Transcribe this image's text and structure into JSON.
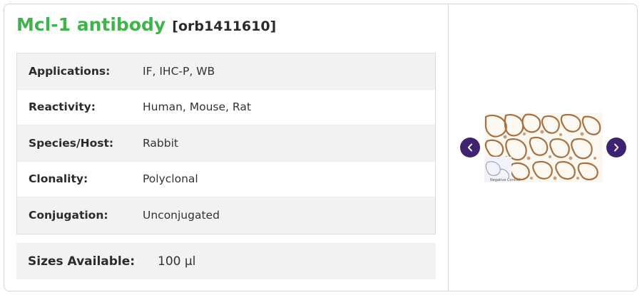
{
  "product": {
    "name": "Mcl-1 antibody",
    "code": "[orb1411610]"
  },
  "specs": [
    {
      "label": "Applications:",
      "value": "IF,  IHC-P,  WB"
    },
    {
      "label": "Reactivity:",
      "value": "Human, Mouse, Rat"
    },
    {
      "label": "Species/Host:",
      "value": "Rabbit"
    },
    {
      "label": "Clonality:",
      "value": "Polyclonal"
    },
    {
      "label": "Conjugation:",
      "value": "Unconjugated"
    }
  ],
  "sizes": {
    "label": "Sizes Available:",
    "value": "100 µl"
  },
  "carousel": {
    "prev_icon": "chevron-left-icon",
    "next_icon": "chevron-right-icon",
    "image_caption": "Negative Control"
  },
  "colors": {
    "title_green": "#3db54a",
    "nav_purple": "#3f2370",
    "row_shade": "#f2f2f2",
    "tissue_brown": "#a9703f"
  }
}
